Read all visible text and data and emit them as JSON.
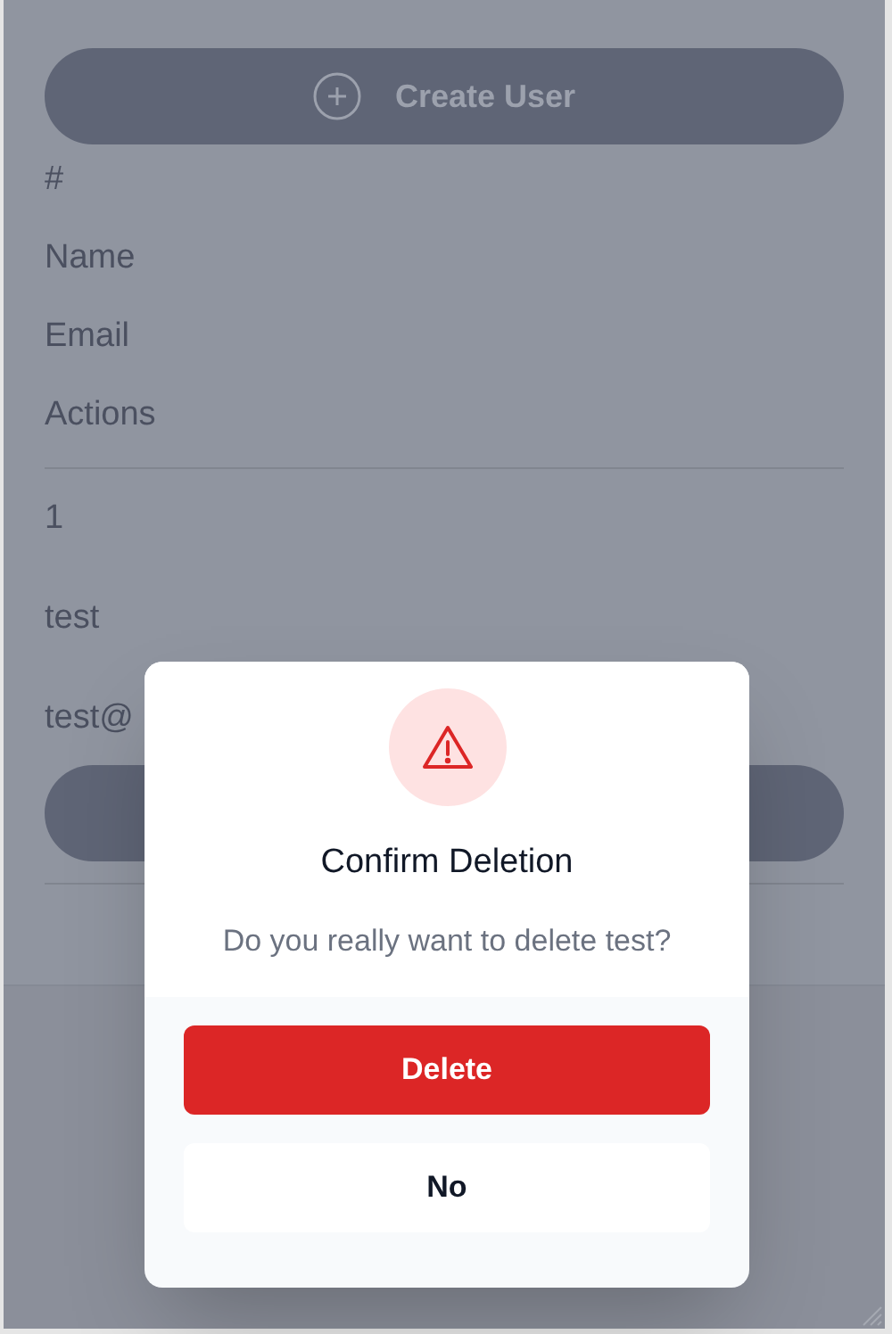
{
  "create_button": {
    "label": "Create User"
  },
  "table": {
    "columns": [
      "#",
      "Name",
      "Email",
      "Actions"
    ],
    "rows": [
      {
        "cells": [
          "1",
          "test",
          "test@"
        ]
      }
    ]
  },
  "dialog": {
    "title": "Confirm Deletion",
    "message": "Do you really want to delete test?",
    "buttons": [
      {
        "label": "Delete",
        "kind": "danger"
      },
      {
        "label": "No",
        "kind": "plain"
      }
    ]
  }
}
